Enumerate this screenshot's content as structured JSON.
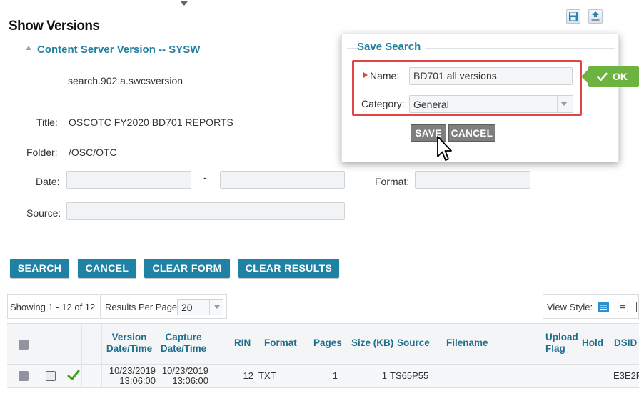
{
  "page": {
    "title": "Show Versions"
  },
  "header_icons": {
    "save": "save-icon",
    "export": "upload-icon"
  },
  "content": {
    "header": "Content Server Version -- SYSW",
    "search_id": "search.902.a.swcsversion",
    "title_label": "Title:",
    "title_value": "OSCOTC FY2020 BD701 REPORTS",
    "folder_label": "Folder:",
    "folder_value": "/OSC/OTC",
    "date_label": "Date:",
    "date_separator": "-",
    "format_label": "Format:",
    "source_label": "Source:"
  },
  "buttons": {
    "search": "SEARCH",
    "cancel": "CANCEL",
    "clear_form": "CLEAR FORM",
    "clear_results": "CLEAR RESULTS"
  },
  "toolbar": {
    "showing": "Showing 1 - 12 of 12",
    "results_per_page_label": "Results Per Page:",
    "results_per_page_value": "20",
    "view_style_label": "View Style:"
  },
  "table": {
    "columns": [
      "",
      "",
      "",
      "Version Date/Time",
      "Capture Date/Time",
      "RIN",
      "Format",
      "Pages",
      "Size (KB)",
      "Source",
      "Filename",
      "Upload Flag",
      "Hold",
      "DSID"
    ],
    "rows": [
      {
        "version_date": "10/23/2019",
        "version_time": "13:06:00",
        "capture_date": "10/23/2019",
        "capture_time": "13:06:00",
        "rin": "12",
        "format": "TXT",
        "pages": "1",
        "size_kb": "1",
        "source": "TS65P55",
        "filename": "",
        "upload_flag": "",
        "hold": "",
        "dsid": "E3E2F"
      }
    ]
  },
  "save_search": {
    "legend": "Save Search",
    "name_label": "Name:",
    "name_value": "BD701 all versions",
    "category_label": "Category:",
    "category_value": "General",
    "save_label": "SAVE",
    "cancel_label": "CANCEL",
    "ok_label": "OK"
  },
  "colors": {
    "accent": "#1f82a5",
    "header_text": "#23809f",
    "ok_green": "#6db33f",
    "highlight_red": "#e04444",
    "check_green": "#3f9e2a"
  }
}
